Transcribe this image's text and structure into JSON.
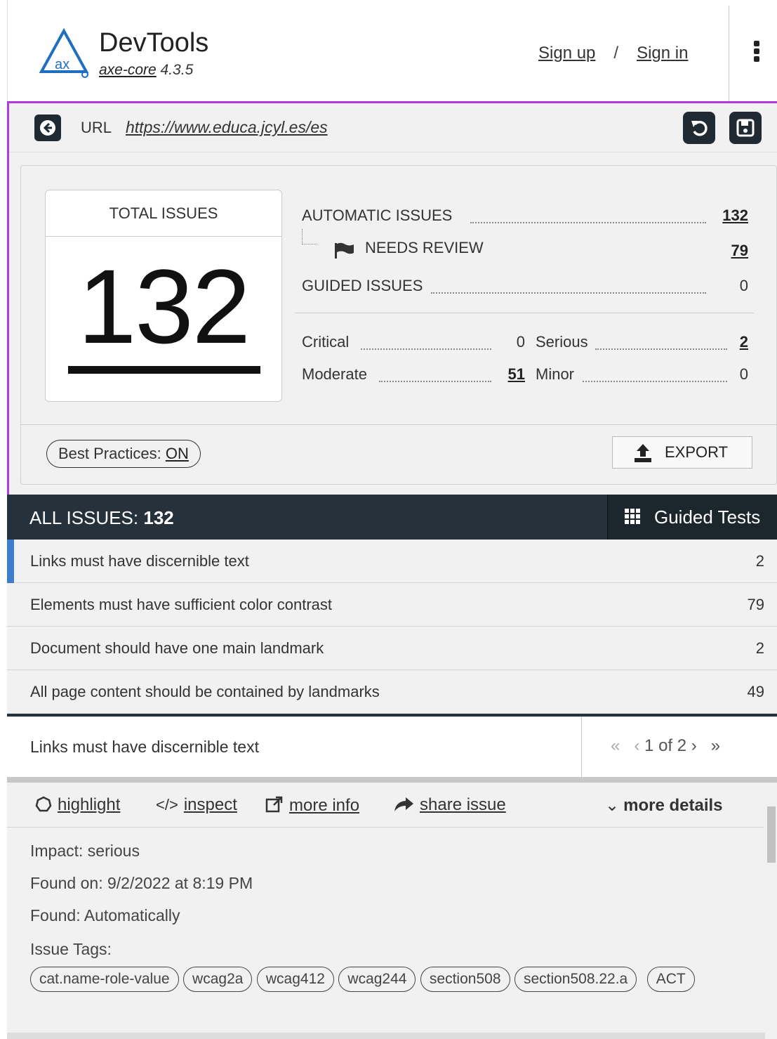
{
  "header": {
    "title": "DevTools",
    "product": "axe-core",
    "version": "4.3.5",
    "logo_text": "ax",
    "sign_up": "Sign up",
    "separator": "/",
    "sign_in": "Sign in"
  },
  "url_bar": {
    "label": "URL",
    "url": "https://www.educa.jcyl.es/es"
  },
  "summary": {
    "total_label": "TOTAL ISSUES",
    "total_value": "132",
    "automatic_label": "AUTOMATIC ISSUES",
    "automatic_value": "132",
    "needs_review_label": "NEEDS REVIEW",
    "needs_review_value": "79",
    "guided_label": "GUIDED ISSUES",
    "guided_value": "0",
    "critical_label": "Critical",
    "critical_value": "0",
    "serious_label": "Serious",
    "serious_value": "2",
    "moderate_label": "Moderate",
    "moderate_value": "51",
    "minor_label": "Minor",
    "minor_value": "0",
    "best_practices_label": "Best Practices:",
    "best_practices_value": "ON",
    "export_label": "EXPORT"
  },
  "issues_bar": {
    "label": "ALL ISSUES:",
    "count": "132",
    "guided_tests": "Guided Tests"
  },
  "issues": [
    {
      "title": "Links must have discernible text",
      "count": "2"
    },
    {
      "title": "Elements must have sufficient color contrast",
      "count": "79"
    },
    {
      "title": "Document should have one main landmark",
      "count": "2"
    },
    {
      "title": "All page content should be contained by landmarks",
      "count": "49"
    }
  ],
  "detail": {
    "title": "Links must have discernible text",
    "pager": "1 of 2",
    "highlight": "highlight",
    "inspect": "inspect",
    "more_info": "more info",
    "share_issue": "share issue",
    "more_details": "more details",
    "impact": "Impact: serious",
    "found_on": "Found on: 9/2/2022 at 8:19 PM",
    "found": "Found: Automatically",
    "tags_label": "Issue Tags:",
    "tags": [
      "cat.name-role-value",
      "wcag2a",
      "wcag412",
      "wcag244",
      "section508",
      "section508.22.a",
      "ACT"
    ]
  },
  "colors": {
    "accent_border": "#b13bdd",
    "dark_bar": "#25323b",
    "active_indicator": "#3d7dca",
    "logo_blue": "#1e6fc0"
  }
}
